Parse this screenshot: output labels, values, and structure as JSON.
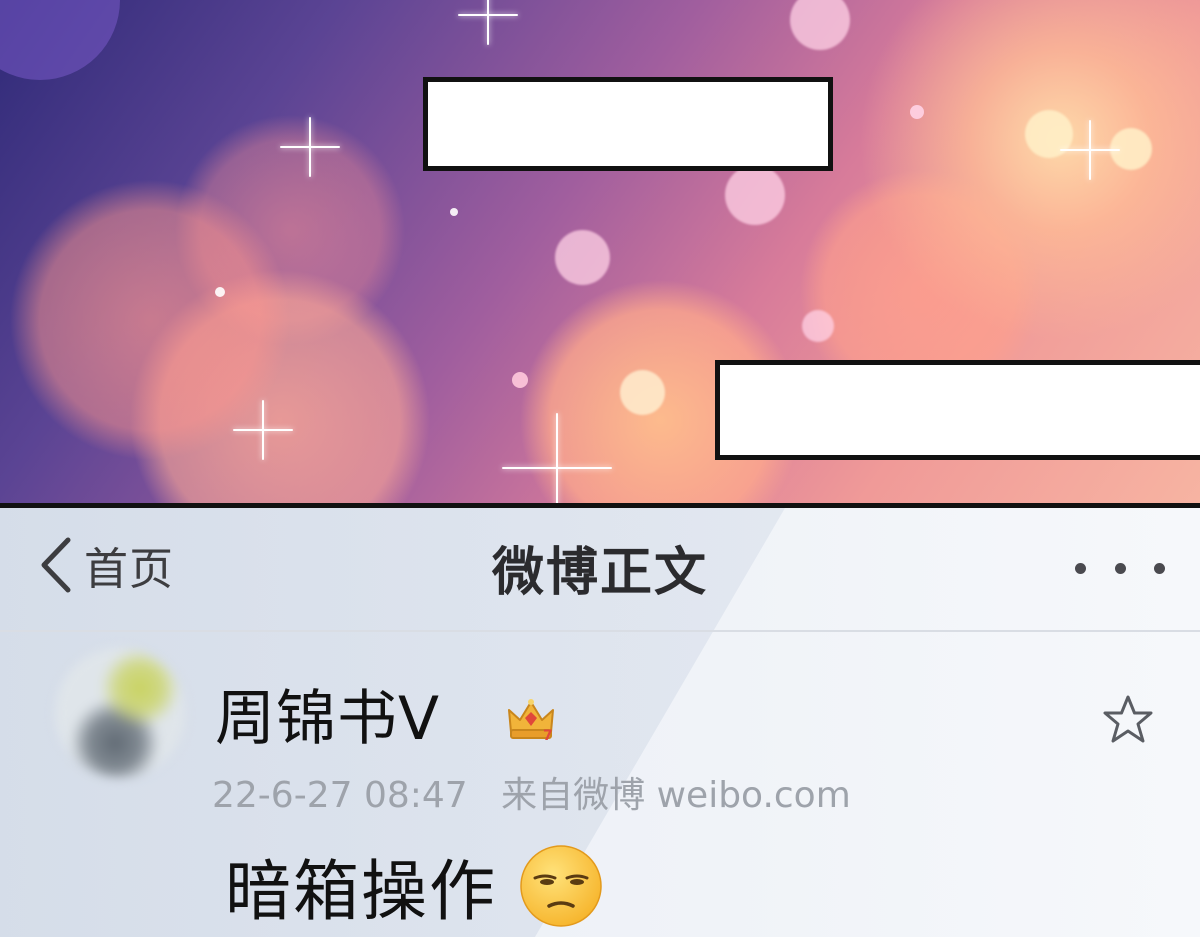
{
  "comic": {
    "speech_box_1": "",
    "speech_box_2": ""
  },
  "navbar": {
    "back_label": "首页",
    "title": "微博正文",
    "back_icon": "chevron-left-icon",
    "more_icon": "more-dots-icon"
  },
  "post": {
    "username": "周锦书V",
    "badge_icon": "crown-icon",
    "favorite_icon": "star-outline-icon",
    "timestamp": "22-6-27 08:47",
    "source": "来自微博 weibo.com",
    "text": "暗箱操作",
    "emoji": "unamused-face-emoji"
  },
  "colors": {
    "title_text": "#2b2b2e",
    "meta_text": "#9ea3ab",
    "badge_gold": "#f1b43a",
    "badge_red": "#e0483a"
  }
}
